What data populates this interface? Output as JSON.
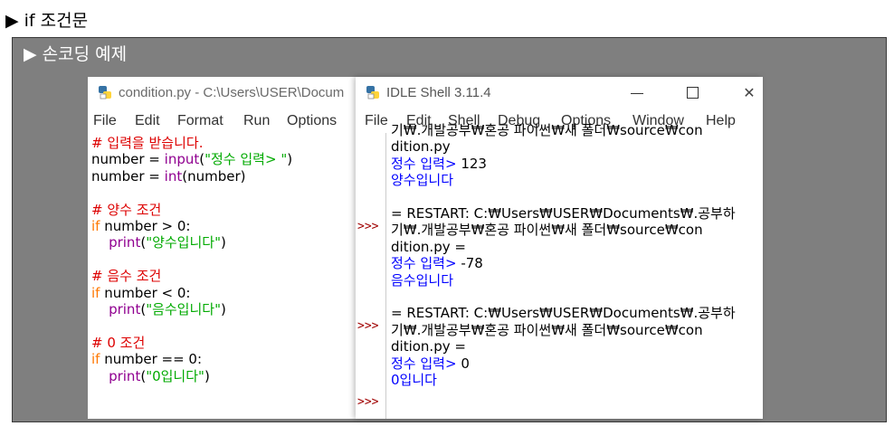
{
  "heading": "▶ if 조건문",
  "panel_title": "▶ 손코딩 예제",
  "editor": {
    "title": "condition.py - C:\\Users\\USER\\Docum",
    "menu": [
      "File",
      "Edit",
      "Format",
      "Run",
      "Options"
    ],
    "code": {
      "l1": "# 입력을 받습니다.",
      "l2a": "number = ",
      "l2b": "input",
      "l2c": "(",
      "l2d": "\"정수 입력> \"",
      "l2e": ")",
      "l3a": "number = ",
      "l3b": "int",
      "l3c": "(number)",
      "l5": "# 양수 조건",
      "l6a": "if",
      "l6b": " number > 0:",
      "l7a": "    ",
      "l7b": "print",
      "l7c": "(",
      "l7d": "\"양수입니다\"",
      "l7e": ")",
      "l9": "# 음수 조건",
      "l10a": "if",
      "l10b": " number < 0:",
      "l11a": "    ",
      "l11b": "print",
      "l11c": "(",
      "l11d": "\"음수입니다\"",
      "l11e": ")",
      "l13": "# 0 조건",
      "l14a": "if",
      "l14b": " number == 0:",
      "l15a": "    ",
      "l15b": "print",
      "l15c": "(",
      "l15d": "\"0입니다\"",
      "l15e": ")"
    }
  },
  "shell": {
    "title": "IDLE Shell 3.11.4",
    "menu": [
      "File",
      "Edit",
      "Shell",
      "Debug",
      "Options",
      "Window",
      "Help"
    ],
    "prompt": ">>>",
    "lines": {
      "s1": "기₩.개발공부₩혼공 파이썬₩새 폴더₩source₩con",
      "s2": "dition.py",
      "s3": "정수 입력> ",
      "s3v": "123",
      "s4": "양수입니다",
      "s6": "= RESTART: C:₩Users₩USER₩Documents₩.공부하",
      "s7": "기₩.개발공부₩혼공 파이썬₩새 폴더₩source₩con",
      "s8": "dition.py =",
      "s9": "정수 입력> ",
      "s9v": "-78",
      "s10": "음수입니다",
      "s12": "= RESTART: C:₩Users₩USER₩Documents₩.공부하",
      "s13": "기₩.개발공부₩혼공 파이썬₩새 폴더₩source₩con",
      "s14": "dition.py =",
      "s15": "정수 입력> ",
      "s15v": "0",
      "s16": "0입니다"
    }
  },
  "colors": {
    "panel": "#7f7f7f",
    "keyword": "#ff7700",
    "builtin": "#900090",
    "string": "#00aa00",
    "comment": "#dd0000",
    "output": "#0000ff"
  }
}
